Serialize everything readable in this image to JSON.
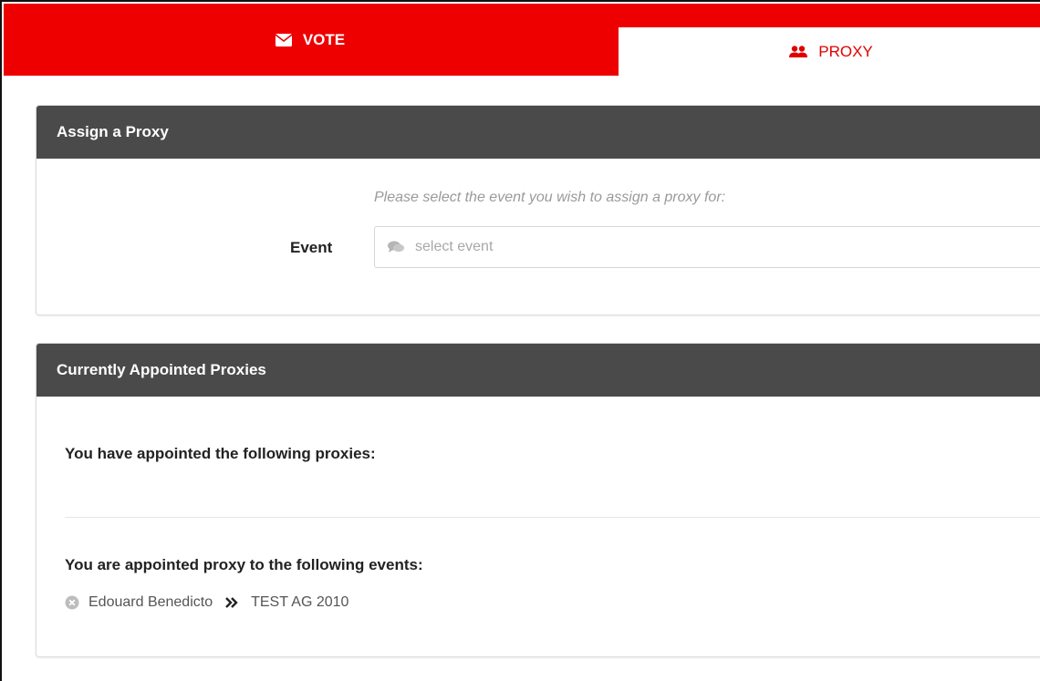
{
  "tabs": {
    "vote": {
      "label": "VOTE",
      "icon": "envelope-icon"
    },
    "proxy": {
      "label": "PROXY",
      "icon": "users-icon"
    }
  },
  "assign_panel": {
    "title": "Assign a Proxy",
    "hint": "Please select the event you wish to assign a proxy for:",
    "event_label": "Event",
    "event_placeholder": "select event",
    "event_icon": "comments-icon"
  },
  "current_panel": {
    "title": "Currently Appointed Proxies",
    "appointed_heading": "You have appointed the following proxies:",
    "proxy_for_heading": "You are appointed proxy to the following events:",
    "entries": [
      {
        "person": "Edouard Benedicto",
        "event": "TEST AG 2010"
      }
    ]
  },
  "colors": {
    "brand_red": "#ee0000",
    "panel_header": "#4a4a4a"
  }
}
